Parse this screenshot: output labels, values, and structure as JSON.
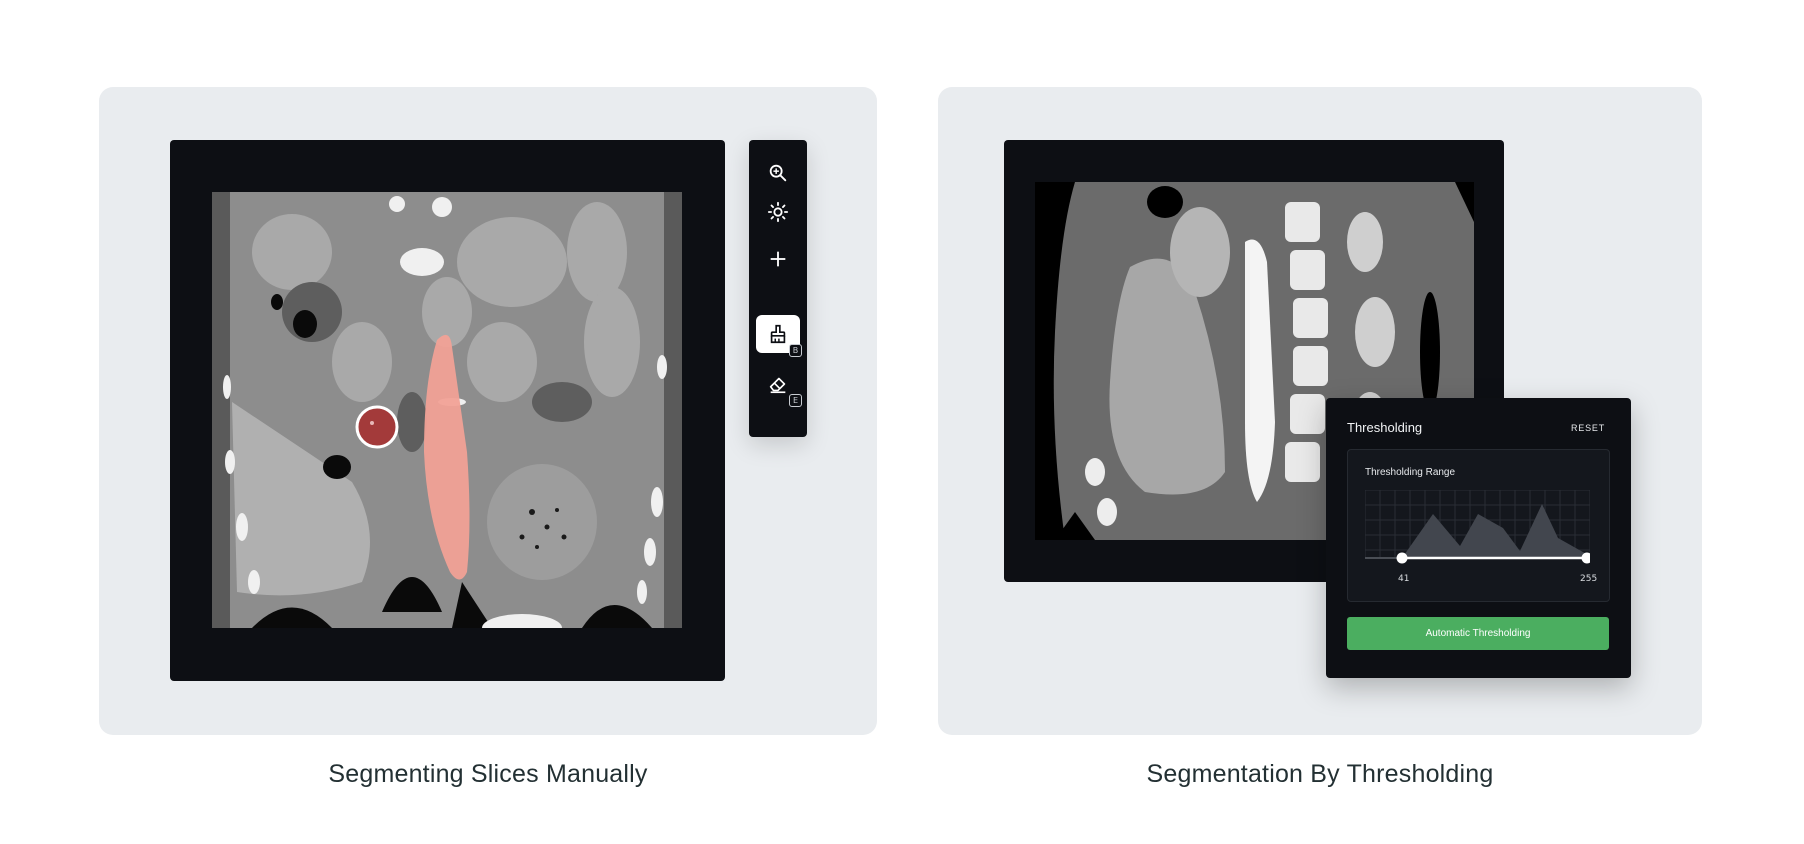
{
  "left_card": {
    "caption": "Segmenting Slices Manually",
    "toolbar": {
      "tools": [
        {
          "name": "zoom-in-icon",
          "shortcut": ""
        },
        {
          "name": "brightness-icon",
          "shortcut": ""
        },
        {
          "name": "crosshair-icon",
          "shortcut": ""
        },
        {
          "name": "brush-icon",
          "shortcut": "B",
          "active": true
        },
        {
          "name": "eraser-icon",
          "shortcut": "E"
        }
      ]
    }
  },
  "right_card": {
    "caption": "Segmentation By Thresholding",
    "thresholding": {
      "title": "Thresholding",
      "reset_label": "RESET",
      "range_title": "Thresholding Range",
      "min_value": "41",
      "max_value": "255",
      "button_label": "Automatic Thresholding"
    }
  },
  "colors": {
    "card_bg": "#e9ecef",
    "viewer_bg": "#0d0f14",
    "segmentation_overlay": "#f1a196",
    "brush_cursor": "#a33a3a",
    "button_green": "#4bae60"
  }
}
